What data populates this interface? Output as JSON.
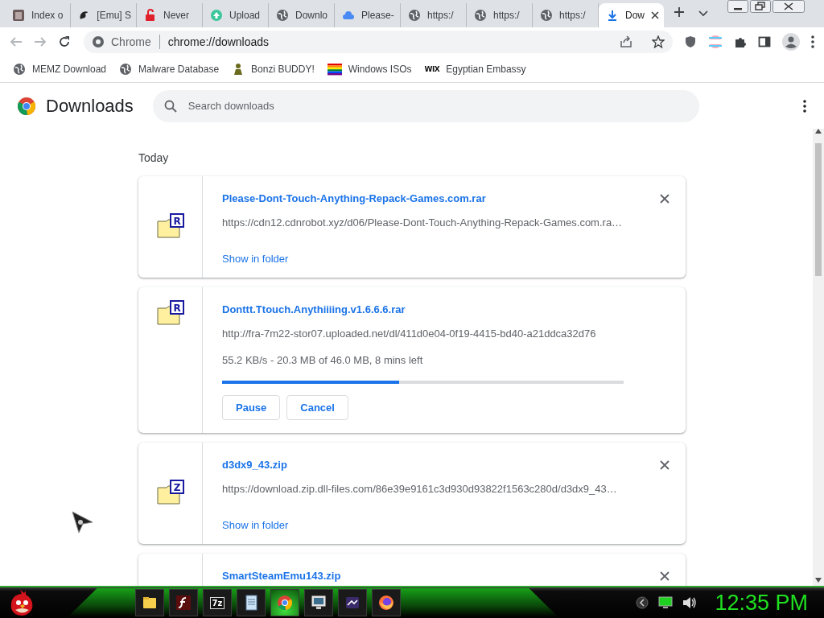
{
  "tabs": [
    {
      "title": "Index o",
      "kind": "picture",
      "selected": false
    },
    {
      "title": "[Emu] S",
      "kind": "dragon",
      "selected": false
    },
    {
      "title": "Never",
      "kind": "lock",
      "selected": false
    },
    {
      "title": "Upload",
      "kind": "upload",
      "selected": false
    },
    {
      "title": "Downlo",
      "kind": "globe",
      "selected": false
    },
    {
      "title": "Please-",
      "kind": "cloud",
      "selected": false
    },
    {
      "title": "https:/",
      "kind": "globe",
      "selected": false
    },
    {
      "title": "https:/",
      "kind": "globe",
      "selected": false
    },
    {
      "title": "https:/",
      "kind": "globe",
      "selected": false
    },
    {
      "title": "Dow",
      "kind": "download",
      "selected": true
    }
  ],
  "address_bar": {
    "site_label": "Chrome",
    "url": "chrome://downloads"
  },
  "bookmarks": [
    {
      "label": "MEMZ Download",
      "kind": "globe"
    },
    {
      "label": "Malware Database",
      "kind": "globe"
    },
    {
      "label": "Bonzi BUDDY!",
      "kind": "figure"
    },
    {
      "label": "Windows ISOs",
      "kind": "rainbow"
    },
    {
      "label": "Egyptian Embassy",
      "kind": "wordmark",
      "logo_text": "WIX"
    }
  ],
  "page": {
    "title": "Downloads",
    "search": {
      "placeholder": "Search downloads"
    },
    "section": "Today",
    "downloads": [
      {
        "kind": "complete",
        "badge": "R",
        "name": "Please-Dont-Touch-Anything-Repack-Games.com.rar",
        "url": "https://cdn12.cdnrobot.xyz/d06/Please-Dont-Touch-Anything-Repack-Games.com.ra…",
        "action": "Show in folder"
      },
      {
        "kind": "in_progress",
        "badge": "R",
        "name": "Donttt.Ttouch.Anythiiiing.v1.6.6.6.rar",
        "url": "http://fra-7m22-stor07.uploaded.net/dl/411d0e04-0f19-4415-bd40-a21ddca32d76",
        "status": "55.2 KB/s - 20.3 MB of 46.0 MB, 8 mins left",
        "level": 0.44,
        "buttons": [
          "Pause",
          "Cancel"
        ]
      },
      {
        "kind": "complete",
        "badge": "Z",
        "name": "d3dx9_43.zip",
        "url": "https://download.zip.dll-files.com/86e39e9161c3d930d93822f1563c280d/d3dx9_43…",
        "action": "Show in folder"
      },
      {
        "kind": "complete",
        "name": "SmartSteamEmu143.zip"
      }
    ]
  },
  "taskbar": {
    "apps": [
      {
        "kind": "folder",
        "selected": false
      },
      {
        "kind": "flash",
        "selected": false
      },
      {
        "kind": "archiver",
        "label": "7z",
        "selected": false
      },
      {
        "kind": "notepad",
        "selected": false
      },
      {
        "kind": "chrome",
        "selected": true
      },
      {
        "kind": "monitor",
        "selected": false
      },
      {
        "kind": "chart",
        "selected": false
      },
      {
        "kind": "firefox",
        "selected": false
      }
    ],
    "clock": "12:35 PM"
  }
}
